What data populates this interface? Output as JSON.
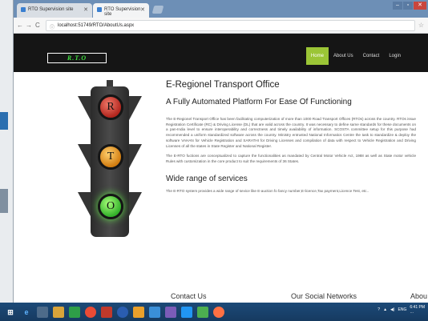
{
  "browser": {
    "tabs": [
      {
        "label": "RTO Supervision site",
        "active": false
      },
      {
        "label": "RTO Supervision site",
        "active": true
      }
    ],
    "url": "localhost:51749/RTO/AboutUs.aspx"
  },
  "navbar": {
    "logo": "R.T.O",
    "menu": [
      "Home",
      "About Us",
      "Contact",
      "Login"
    ]
  },
  "traffic_light": {
    "red": "R",
    "amber": "T",
    "green": "O"
  },
  "content": {
    "title": "E-Regionel Transport Office",
    "subtitle": "A Fully Automated Platform For Ease Of Functioning",
    "paragraph1": "The E-Regionel Transport Office has been facilitating computerization of more than 1000 Road Transport Offices (RTOs) across the country. RTOs issue Registration Certificate (RC) & Driving License (DL) that are valid across the country. It was necessary to define same standards for these documents on a pan-India level to ensure interoperability and correctness and timely availability of information. SCOSTA committee setup for this purpose had recommended a uniform standardized software across the country. Ministry entrusted National Informatics Centre the task to standardize & deploy the software VAHAN for Vehicle Registration and SARATHI for Driving Licenses and compilation of data with respect to Vehicle Registration and Driving Licenses of all the states in State Register and National Register.",
    "paragraph2": "The E-RTO fuctions are conceptualized to capture the functionalities as mandated by Central Motor Vehicle Act, 1988 as well as State motor vehicle Rules with customization in the core product to suit the requirements of 36 States.",
    "section_title": "Wide range of services",
    "paragraph3": "The E-RTO system provides a wide range of sevice like E-auction fo fancy number,E-licence,Tax payment,Licence Test, etc.."
  },
  "footer": {
    "contact": "Contact Us",
    "social": "Our Social Networks",
    "about": "Abou"
  },
  "taskbar": {
    "language": "ENG",
    "time": "6:41 PM",
    "date": "…"
  }
}
